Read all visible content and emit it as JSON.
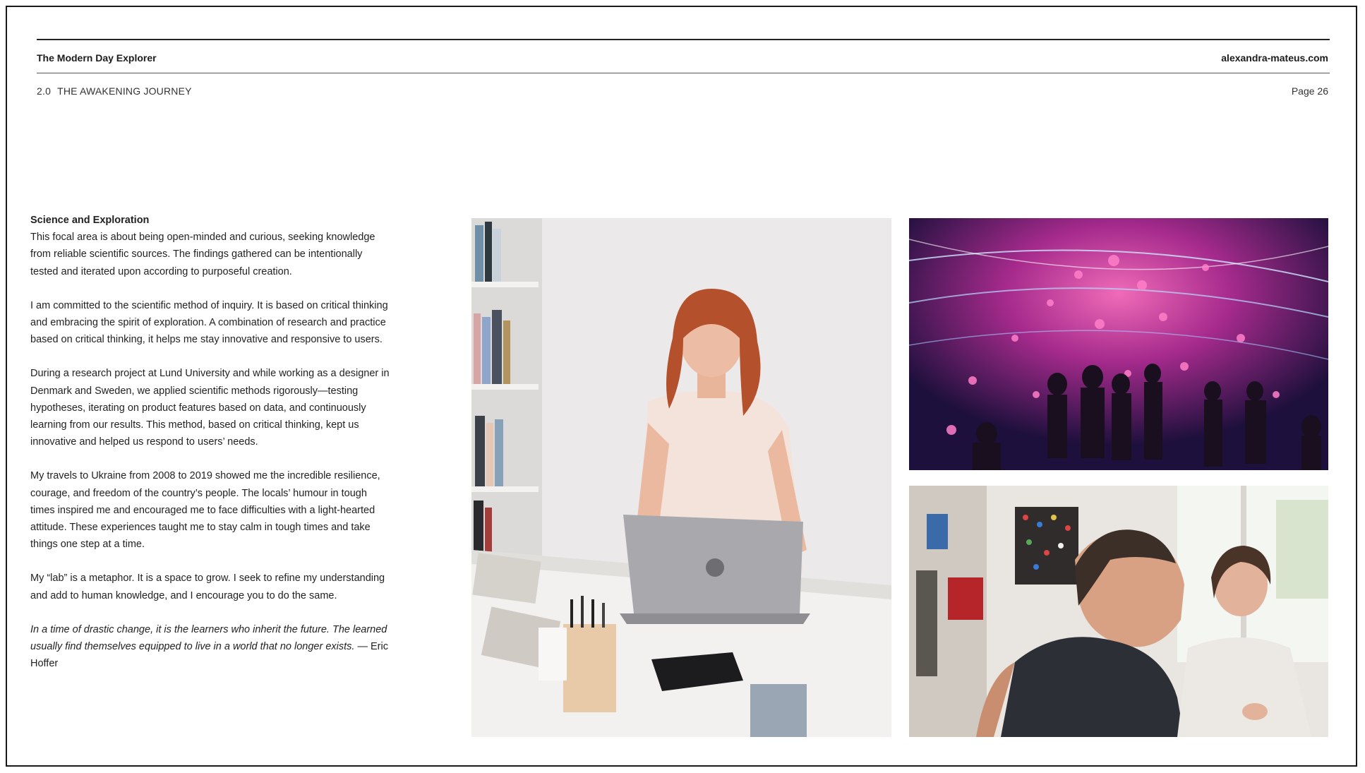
{
  "header": {
    "title": "The Modern Day Explorer",
    "site": "alexandra-mateus.com",
    "section_number": "2.0",
    "section_title": "THE AWAKENING JOURNEY",
    "page": "Page 26"
  },
  "content": {
    "heading": "Science and Exploration",
    "paragraphs": [
      "This focal area is about being open-minded and curious, seeking knowledge from reliable scientific sources. The findings gathered can be intentionally tested and iterated upon according to purposeful creation.",
      "I am committed to the scientific method of inquiry. It is based on critical thinking and embracing the spirit of exploration. A combination of research and practice based on critical thinking, it helps me stay innovative and responsive to users.",
      "During a research project at Lund University and while working as a designer in Denmark and Sweden, we applied scientific methods rigorously—testing hypotheses, iterating on product features based on data, and continuously learning from our results. This method, based on critical thinking, kept us innovative and helped us respond to users’ needs.",
      "My travels to Ukraine from 2008 to 2019 showed me the incredible resilience, courage, and freedom of the country’s people. The locals’ humour in tough times inspired me and encouraged me to face difficulties with a light-hearted attitude. These experiences taught me to stay calm in tough times and take things one step at a time.",
      "My “lab” is a metaphor. It is a space to grow. I seek to refine my understanding and add to human knowledge, and I encourage you to do the same."
    ],
    "quote": "In a time of drastic change, it is the learners who inherit the future. The learned usually find themselves equipped to live in a world that no longer exists.",
    "quote_author": " — Eric Hoffer"
  },
  "images": [
    {
      "name": "woman-laptop-photo",
      "icon": "photo-woman-with-laptop"
    },
    {
      "name": "digital-art-photo",
      "icon": "photo-immersive-digital-art"
    },
    {
      "name": "workshop-photo",
      "icon": "photo-two-women-workshop"
    }
  ]
}
